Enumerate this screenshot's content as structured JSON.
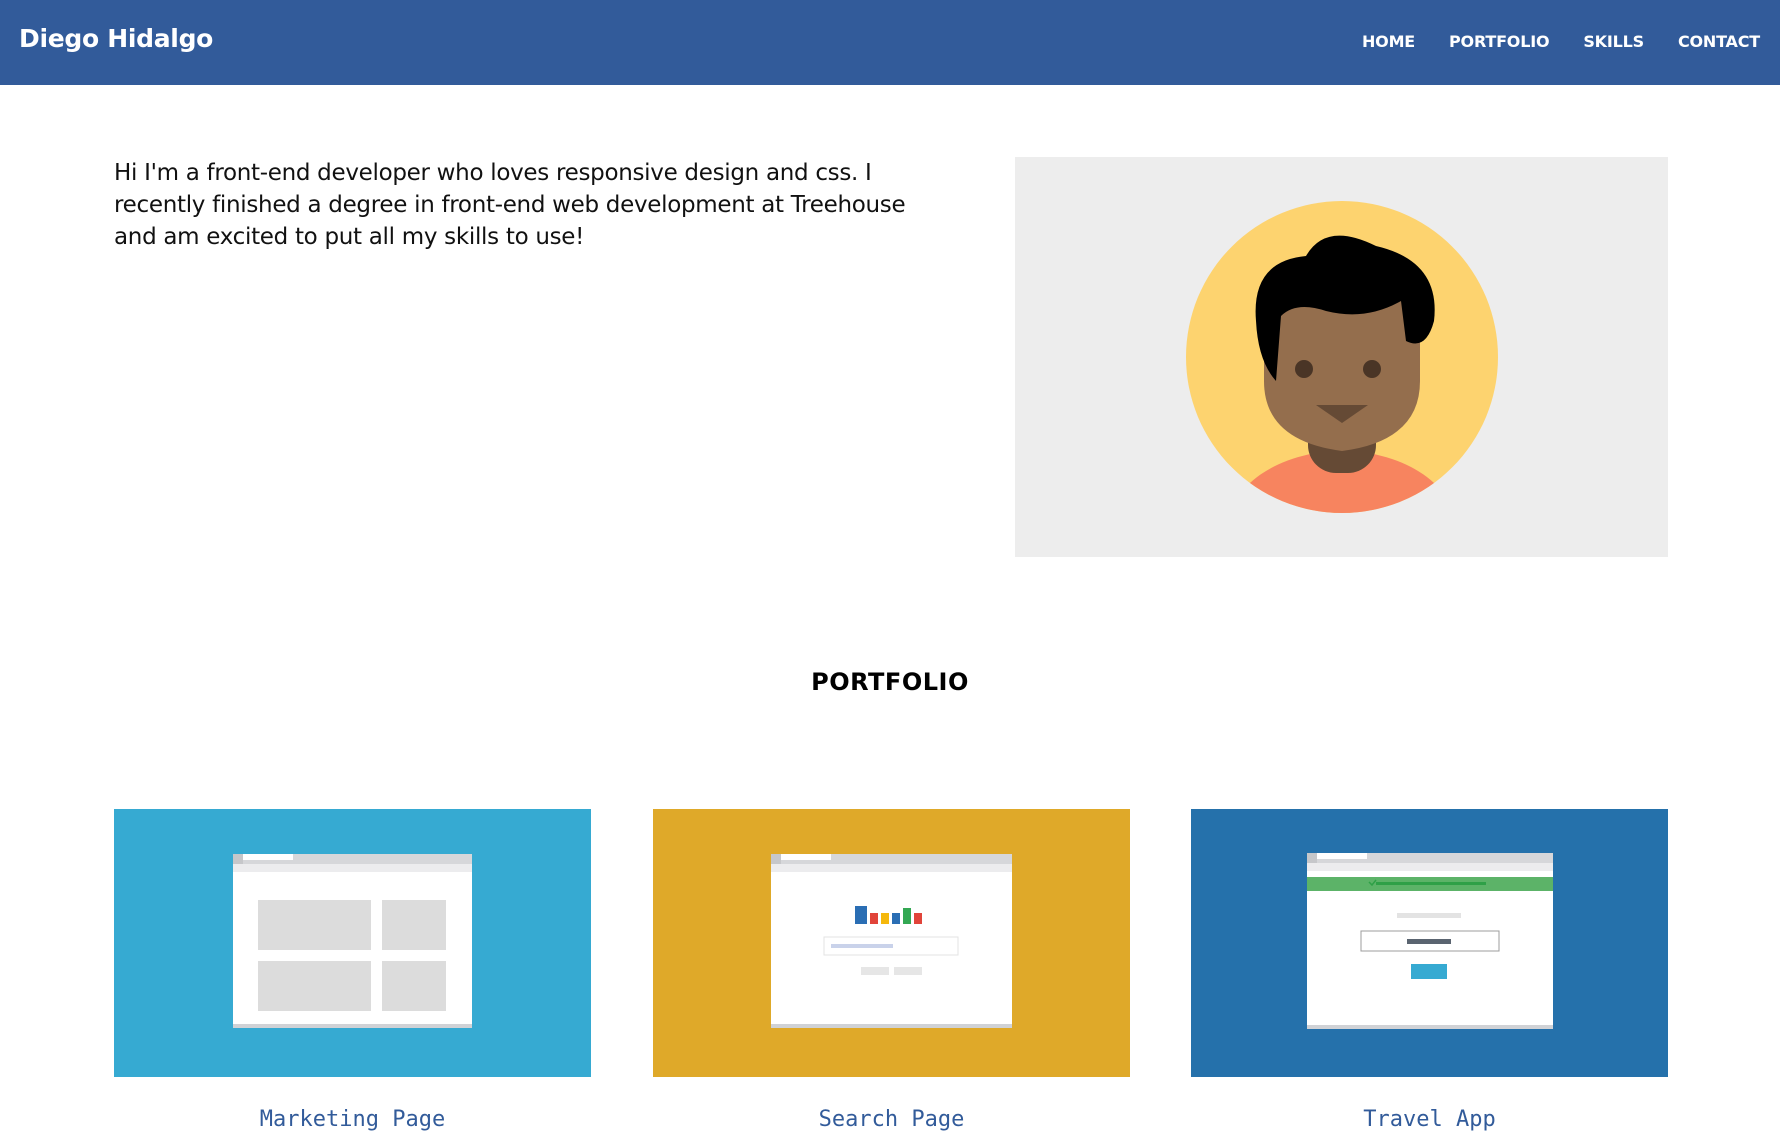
{
  "header": {
    "brand": "Diego Hidalgo",
    "nav": [
      {
        "label": "HOME"
      },
      {
        "label": "PORTFOLIO"
      },
      {
        "label": "SKILLS"
      },
      {
        "label": "CONTACT"
      }
    ],
    "background_color": "#325b9a"
  },
  "intro": {
    "text": "Hi I'm a front-end developer who loves responsive design and css. I recently finished a degree in front-end web development at Treehouse and am excited to put all my skills to use!"
  },
  "avatar": {
    "icon": "avatar-illustration",
    "background_color": "#ededed",
    "circle_color": "#fdd36f"
  },
  "portfolio": {
    "title": "PORTFOLIO",
    "projects": [
      {
        "label": "Marketing Page",
        "color": "#36aad2",
        "icon": "layout-grid-icon"
      },
      {
        "label": "Search Page",
        "color": "#dfa929",
        "icon": "search-chart-icon"
      },
      {
        "label": "Travel App",
        "color": "#2571ab",
        "icon": "travel-form-icon"
      }
    ]
  }
}
